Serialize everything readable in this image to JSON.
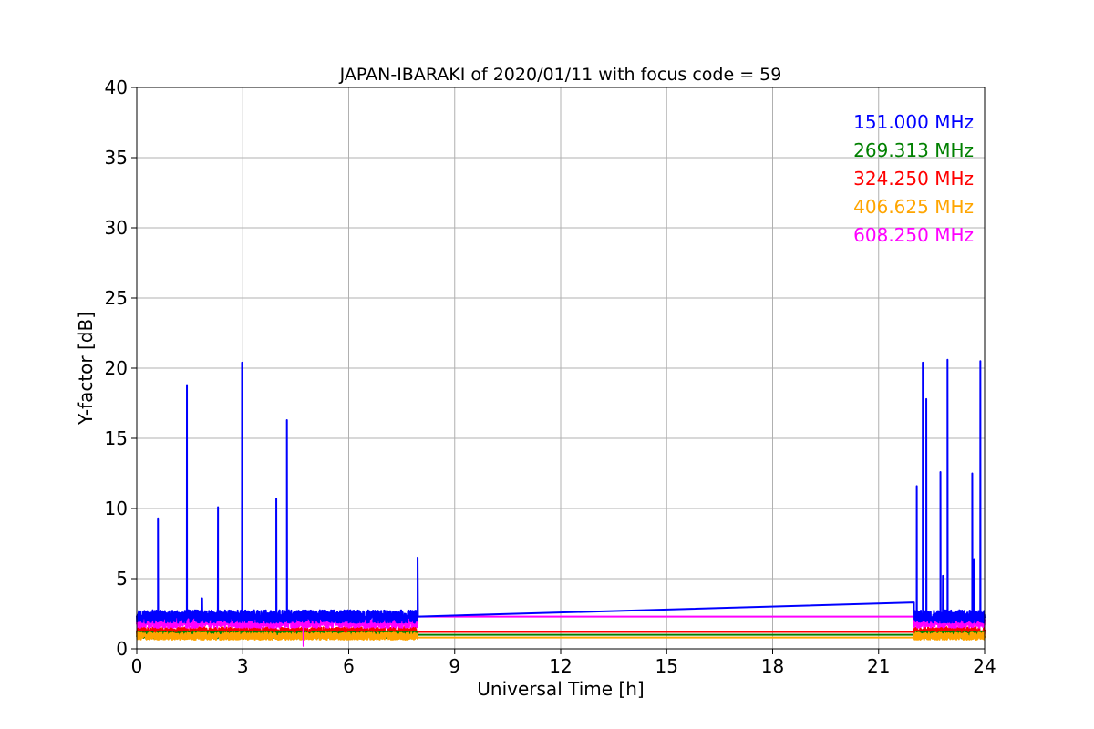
{
  "chart_data": {
    "type": "line",
    "title": "JAPAN-IBARAKI of 2020/01/11 with focus code = 59",
    "xlabel": "Universal Time [h]",
    "ylabel": "Y-factor [dB]",
    "xlim": [
      0,
      24
    ],
    "ylim": [
      0,
      40
    ],
    "xticks": [
      0,
      3,
      6,
      9,
      12,
      15,
      18,
      21,
      24
    ],
    "yticks": [
      0,
      5,
      10,
      15,
      20,
      25,
      30,
      35,
      40
    ],
    "grid": true,
    "legend_position": "top-right",
    "series": [
      {
        "name": "151.000 MHz",
        "color": "#0000ff",
        "baseline": 2.3,
        "noise": 0.45,
        "gap_level": 3.3,
        "spikes": [
          [
            0.6,
            9.3
          ],
          [
            1.42,
            18.8
          ],
          [
            1.85,
            3.6
          ],
          [
            2.3,
            10.1
          ],
          [
            2.98,
            20.4
          ],
          [
            3.95,
            10.7
          ],
          [
            4.25,
            16.3
          ],
          [
            7.95,
            6.5
          ],
          [
            22.08,
            11.6
          ],
          [
            22.25,
            20.4
          ],
          [
            22.35,
            17.8
          ],
          [
            22.75,
            12.6
          ],
          [
            22.82,
            5.2
          ],
          [
            22.95,
            20.6
          ],
          [
            23.65,
            12.5
          ],
          [
            23.7,
            6.4
          ],
          [
            23.88,
            20.5
          ]
        ]
      },
      {
        "name": "269.313 MHz",
        "color": "#008000",
        "baseline": 1.0,
        "noise": 0.25,
        "gap_level": 1.0,
        "spikes": []
      },
      {
        "name": "324.250 MHz",
        "color": "#ff0000",
        "baseline": 1.2,
        "noise": 0.35,
        "gap_level": 1.2,
        "spikes": []
      },
      {
        "name": "406.625 MHz",
        "color": "#ffa500",
        "baseline": 0.9,
        "noise": 0.25,
        "gap_level": 0.8,
        "spikes": []
      },
      {
        "name": "608.250 MHz",
        "color": "#ff00ff",
        "baseline": 1.9,
        "noise": 0.4,
        "gap_level": 2.3,
        "spikes": [
          [
            4.72,
            0.2
          ]
        ]
      }
    ],
    "segments": [
      [
        0,
        7.95,
        "data"
      ],
      [
        7.95,
        22.0,
        "gap"
      ],
      [
        22.0,
        24,
        "data"
      ]
    ]
  }
}
